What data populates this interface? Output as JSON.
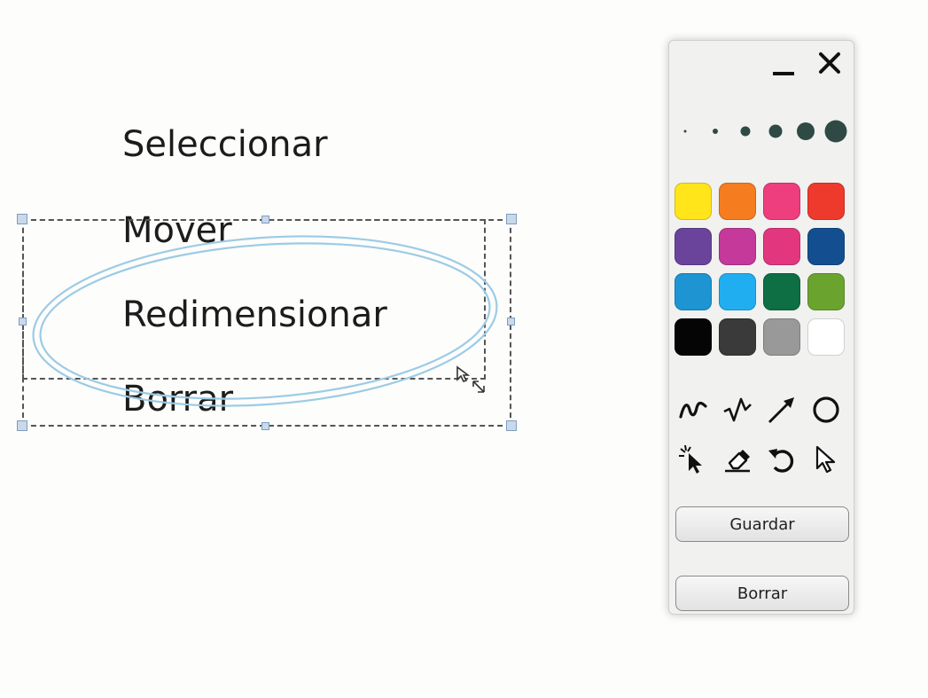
{
  "canvas": {
    "words": [
      "Seleccionar",
      "Mover",
      "Redimensionar",
      "Borrar"
    ]
  },
  "panel": {
    "window_controls": [
      {
        "name": "minimize",
        "icon": "minus-icon"
      },
      {
        "name": "close",
        "icon": "close-icon"
      }
    ],
    "brush_sizes": [
      3,
      6,
      11,
      15,
      20,
      25
    ],
    "brush_color": "#2f4a45",
    "colors": [
      "#ffe51a",
      "#f57d1f",
      "#ee3e7d",
      "#ee3a2c",
      "#6a449a",
      "#c4399a",
      "#e2377e",
      "#134f90",
      "#1e94d3",
      "#21aef0",
      "#0e6e44",
      "#6aa42f",
      "#050505",
      "#3a3a3a",
      "#999999",
      "#ffffff"
    ],
    "tools": [
      {
        "name": "freehand",
        "icon": "freehand-line-icon"
      },
      {
        "name": "polyline",
        "icon": "polyline-icon"
      },
      {
        "name": "arrow",
        "icon": "arrow-icon"
      },
      {
        "name": "ellipse",
        "icon": "ellipse-icon"
      },
      {
        "name": "pointer",
        "icon": "laser-pointer-icon"
      },
      {
        "name": "eraser",
        "icon": "eraser-icon"
      },
      {
        "name": "undo",
        "icon": "undo-icon"
      },
      {
        "name": "select",
        "icon": "select-cursor-icon"
      }
    ],
    "save_label": "Guardar",
    "clear_label": "Borrar"
  },
  "selection": {
    "ellipse_color": "#9ccbe5",
    "handle_color": "#c9d9ea"
  }
}
